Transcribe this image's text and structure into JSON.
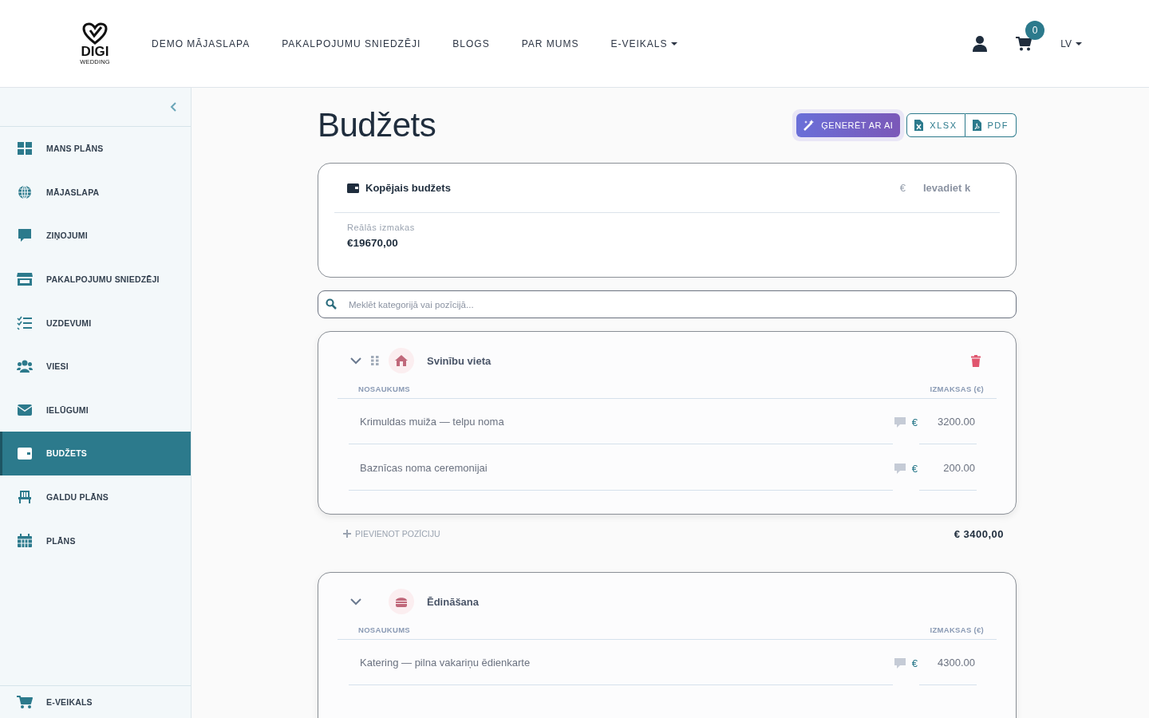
{
  "header": {
    "logo": {
      "brand": "DIGI",
      "sub": "WEDDING"
    },
    "nav": [
      {
        "label": "DEMO MĀJASLAPA",
        "dropdown": false
      },
      {
        "label": "PAKALPOJUMU SNIEDZĒJI",
        "dropdown": false
      },
      {
        "label": "BLOGS",
        "dropdown": false
      },
      {
        "label": "PAR MUMS",
        "dropdown": false
      },
      {
        "label": "E-VEIKALS",
        "dropdown": true
      }
    ],
    "cart_count": "0",
    "language": "LV"
  },
  "sidebar": {
    "items": [
      {
        "label": "MANS PLĀNS",
        "selected": false
      },
      {
        "label": "MĀJASLAPA",
        "selected": false
      },
      {
        "label": "ZIŅOJUMI",
        "selected": false
      },
      {
        "label": "PAKALPOJUMU SNIEDZĒJI",
        "selected": false
      },
      {
        "label": "UZDEVUMI",
        "selected": false
      },
      {
        "label": "VIESI",
        "selected": false
      },
      {
        "label": "IELŪGUMI",
        "selected": false
      },
      {
        "label": "BUDŽETS",
        "selected": true
      },
      {
        "label": "GALDU PLĀNS",
        "selected": false
      },
      {
        "label": "PLĀNS",
        "selected": false
      }
    ],
    "footer_item": {
      "label": "E-VEIKALS"
    }
  },
  "page": {
    "title": "Budžets",
    "buttons": [
      {
        "label": "ĢENERĒT AR AI",
        "kind": "ai"
      },
      {
        "label": "XLSX",
        "kind": "xlsx"
      },
      {
        "label": "PDF",
        "kind": "pdf"
      }
    ]
  },
  "total_budget": {
    "title": "Kopējais budžets",
    "currency": "€",
    "placeholder": "Ievadiet k",
    "actual_label": "Reālās izmakas",
    "actual_value": "€19670,00"
  },
  "search": {
    "placeholder": "Meklēt kategorijā vai pozīcijā..."
  },
  "categories": [
    {
      "name": "Svinību vieta",
      "expanded": true,
      "drag_handle": true,
      "deletable": true,
      "col_name": "NOSAUKUMS",
      "col_cost": "IZMAKSAS (€)",
      "add_label": "PIEVIENOT POZĪCIJU",
      "total": "€ 3400,00",
      "items": [
        {
          "name": "Krimuldas muiža — telpu noma",
          "currency": "€",
          "amount": "3200.00"
        },
        {
          "name": "Baznīcas noma ceremonijai",
          "currency": "€",
          "amount": "200.00"
        }
      ]
    },
    {
      "name": "Ēdināšana",
      "expanded": true,
      "drag_handle": false,
      "deletable": false,
      "col_name": "NOSAUKUMS",
      "col_cost": "IZMAKSAS (€)",
      "items": [
        {
          "name": "Katering — pilna vakariņu ēdienkarte",
          "currency": "€",
          "amount": "4300.00"
        }
      ]
    }
  ]
}
